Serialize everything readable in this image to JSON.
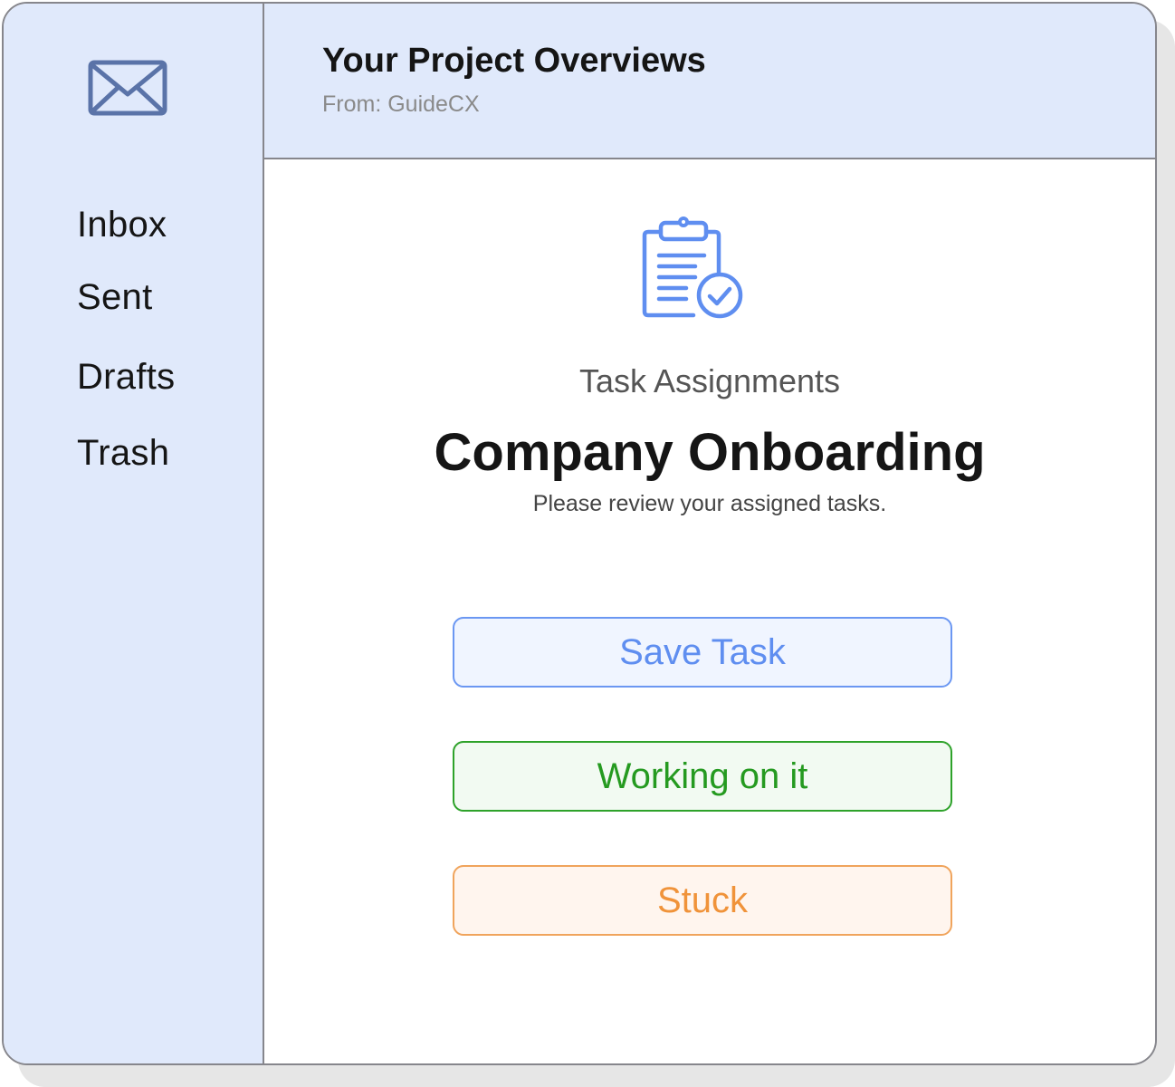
{
  "sidebar": {
    "icon": "mail-icon",
    "items": [
      {
        "label": "Inbox"
      },
      {
        "label": "Sent"
      },
      {
        "label": "Drafts"
      },
      {
        "label": "Trash"
      }
    ]
  },
  "header": {
    "title": "Your Project Overviews",
    "from": "From: GuideCX"
  },
  "main": {
    "icon": "clipboard-check-icon",
    "subtitle": "Task Assignments",
    "title": "Company Onboarding",
    "description": "Please review your assigned tasks.",
    "buttons": {
      "save_label": "Save Task",
      "working_label": "Working on it",
      "stuck_label": "Stuck"
    }
  },
  "colors": {
    "panel_bg": "#e0e9fb",
    "border": "#86868c",
    "accent_blue": "#5f8ef0",
    "status_green": "#259a20",
    "status_orange": "#f0933a"
  }
}
